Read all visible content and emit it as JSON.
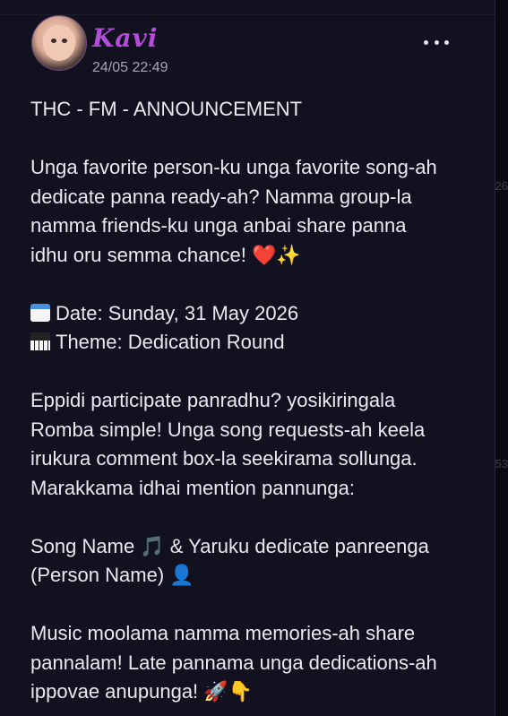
{
  "post": {
    "author": "Kavi",
    "timestamp": "24/05 22:49",
    "title": "THC - FM - ANNOUNCEMENT",
    "intro_line1": "Unga favorite person-ku unga favorite song-ah",
    "intro_line2": "dedicate panna ready-ah? Namma group-la",
    "intro_line3": "namma friends-ku unga anbai share panna",
    "intro_line4": "idhu oru semma chance! ❤️✨",
    "date_line": "Date: Sunday, 31 May 2026",
    "theme_line": "Theme: Dedication Round",
    "how_line1": "Eppidi participate panradhu? yosikiringala",
    "how_line2": "Romba simple! Unga song requests-ah keela",
    "how_line3": "irukura comment box-la seekirama sollunga.",
    "how_line4": "Marakkama idhai mention pannunga:",
    "format_line1": "Song Name 🎵 & Yaruku dedicate panreenga",
    "format_line2": "(Person Name) 👤",
    "outro_line1": "Music moolama namma memories-ah share",
    "outro_line2": "pannalam! Late pannama unga dedications-ah",
    "outro_line3": "ippovae anupunga! 🚀👇"
  },
  "background_fragments": [
    "26",
    "53"
  ],
  "colors": {
    "card_bg": "#121120",
    "username": "#b44ddb",
    "text": "#e9eaf0",
    "muted": "#a3a6b3"
  },
  "icons": [
    "calendar-icon",
    "piano-icon",
    "more-options-icon"
  ]
}
